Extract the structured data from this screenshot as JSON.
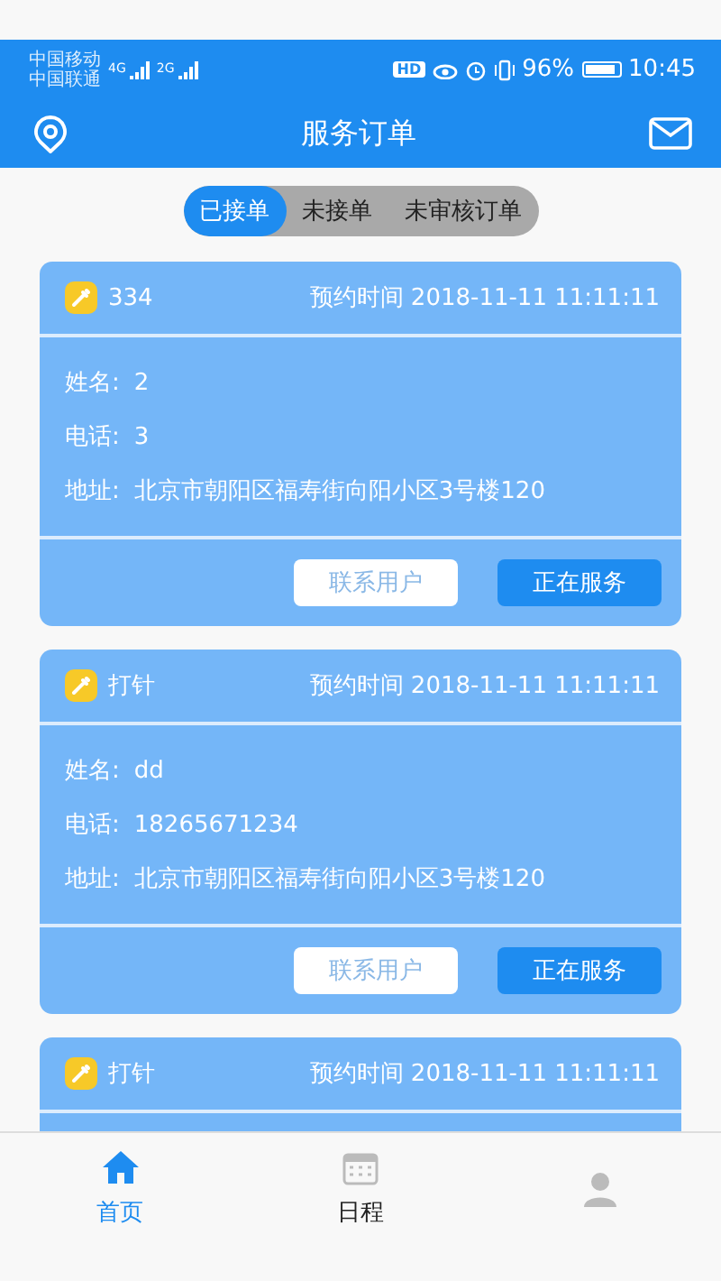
{
  "status_bar": {
    "carriers": [
      "中国移动",
      "中国联通"
    ],
    "networks": [
      "4G",
      "2G"
    ],
    "hd": "HD",
    "battery_text": "96%",
    "time": "10:45"
  },
  "app_bar": {
    "title": "服务订单"
  },
  "tabs": [
    {
      "label": "已接单",
      "selected": true
    },
    {
      "label": "未接单",
      "selected": false
    },
    {
      "label": "未审核订单",
      "selected": false
    }
  ],
  "orders": [
    {
      "title": "334",
      "time": "预约时间 2018-11-11 11:11:11",
      "fields": [
        {
          "label": "姓名:",
          "value": "2"
        },
        {
          "label": "电话:",
          "value": "3"
        },
        {
          "label": "地址:",
          "value": "北京市朝阳区福寿街向阳小区3号楼120"
        }
      ],
      "buttons": [
        {
          "label": "联系用户",
          "kind": "outline"
        },
        {
          "label": "正在服务",
          "kind": "primary"
        }
      ]
    },
    {
      "title": "打针",
      "time": "预约时间 2018-11-11 11:11:11",
      "fields": [
        {
          "label": "姓名:",
          "value": "dd"
        },
        {
          "label": "电话:",
          "value": "18265671234"
        },
        {
          "label": "地址:",
          "value": "北京市朝阳区福寿街向阳小区3号楼120"
        }
      ],
      "buttons": [
        {
          "label": "联系用户",
          "kind": "outline"
        },
        {
          "label": "正在服务",
          "kind": "primary"
        }
      ]
    },
    {
      "title": "打针",
      "time": "预约时间 2018-11-11 11:11:11"
    }
  ],
  "nav": [
    {
      "label": "首页",
      "kind": "home",
      "selected": true
    },
    {
      "label": "日程",
      "kind": "calendar",
      "selected": false
    },
    {
      "kind": "person",
      "selected": false
    }
  ]
}
